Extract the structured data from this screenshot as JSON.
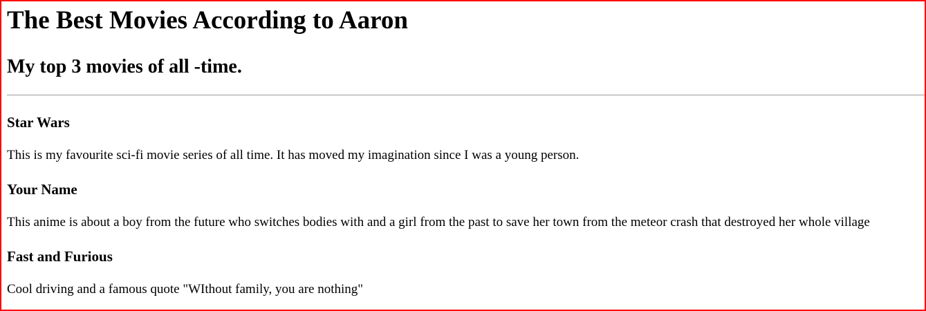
{
  "page": {
    "title": "The Best Movies According to Aaron",
    "subtitle": "My top 3 movies of all -time."
  },
  "movies": [
    {
      "title": "Star Wars",
      "description": "This is my favourite sci-fi movie series of all time. It has moved my imagination since I was a young person."
    },
    {
      "title": "Your Name",
      "description": "This anime is about a boy from the future who switches bodies with and a girl from the past to save her town from the meteor crash that destroyed her whole village"
    },
    {
      "title": "Fast and Furious",
      "description": "Cool driving and a famous quote \"WIthout family, you are nothing\""
    }
  ],
  "colors": {
    "frame_border": "#ff0000",
    "rule": "#9a9a9a",
    "text": "#000000",
    "background": "#ffffff"
  }
}
